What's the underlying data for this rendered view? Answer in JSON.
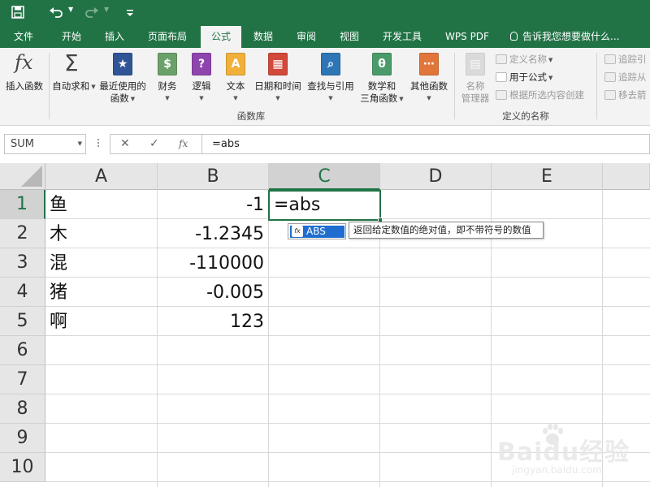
{
  "titlebar": {
    "save_icon": "save-icon",
    "undo_icon": "undo-icon",
    "redo_icon": "redo-icon",
    "customize_icon": "customize-qat-icon",
    "accent": "#217346"
  },
  "tabs": [
    {
      "label": "文件"
    },
    {
      "label": "开始"
    },
    {
      "label": "插入"
    },
    {
      "label": "页面布局"
    },
    {
      "label": "公式",
      "active": true
    },
    {
      "label": "数据"
    },
    {
      "label": "审阅"
    },
    {
      "label": "视图"
    },
    {
      "label": "开发工具"
    },
    {
      "label": "WPS PDF"
    }
  ],
  "tell_me": "告诉我您想要做什么...",
  "ribbon": {
    "insert_function": "插入函数",
    "library": {
      "autosum": "自动求和",
      "recent_line1": "最近使用的",
      "recent_line2": "函数",
      "financial": "财务",
      "logical": "逻辑",
      "text": "文本",
      "datetime": "日期和时间",
      "lookup": "查找与引用",
      "math_line1": "数学和",
      "math_line2": "三角函数",
      "more": "其他函数",
      "group_label": "函数库"
    },
    "names": {
      "manager_line1": "名称",
      "manager_line2": "管理器",
      "define_name": "定义名称",
      "use_in_formula": "用于公式",
      "create_from_selection": "根据所选内容创建",
      "group_label": "定义的名称"
    },
    "audit": {
      "trace_precedents": "追踪引",
      "trace_dependents": "追踪从",
      "remove_arrows": "移去箭"
    }
  },
  "formula_bar": {
    "name_box": "SUM",
    "cancel_icon": "cancel-icon",
    "enter_icon": "check-icon",
    "fx_label": "fx",
    "value": "=abs"
  },
  "sheet": {
    "columns": [
      "A",
      "B",
      "C",
      "D",
      "E"
    ],
    "rows": [
      "1",
      "2",
      "3",
      "4",
      "5",
      "6",
      "7",
      "8",
      "9",
      "10"
    ],
    "col_a": [
      "鱼",
      "木",
      "混",
      "猪",
      "啊"
    ],
    "col_b": [
      "-1",
      "-1.2345",
      "-110000",
      "-0.005",
      "123"
    ],
    "active_cell": {
      "column": "C",
      "row": "1",
      "edit_text": "=abs"
    }
  },
  "autocomplete": {
    "item": "ABS",
    "fx_icon": "fx",
    "tooltip": "返回给定数值的绝对值，即不带符号的数值"
  },
  "watermark": {
    "brand": "Baidu经验",
    "url": "jingyan.baidu.com"
  }
}
